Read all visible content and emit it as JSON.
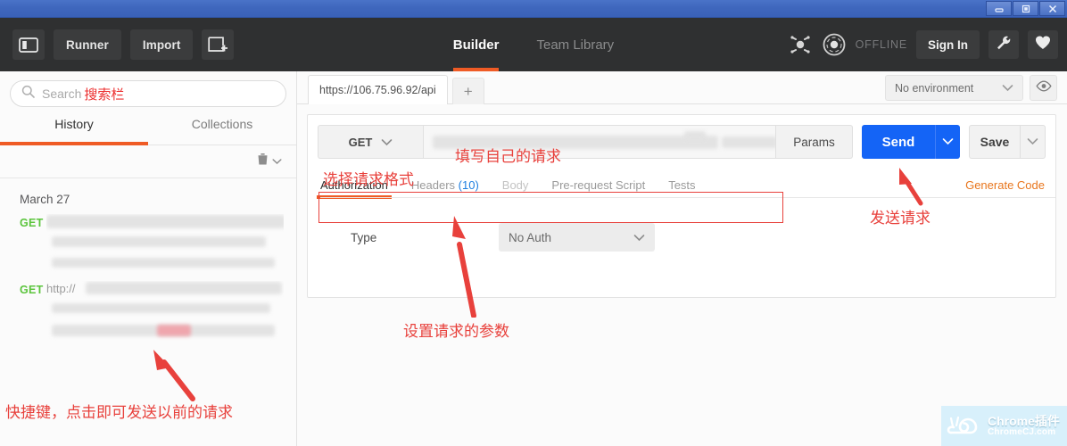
{
  "window": {
    "minimize_label": "Minimize",
    "maximize_label": "Maximize",
    "close_label": "Close"
  },
  "header": {
    "sidebar_toggle_icon": "sidebar-toggle-icon",
    "runner_label": "Runner",
    "import_label": "Import",
    "new_window_icon": "new-window-icon",
    "tabs": [
      {
        "label": "Builder",
        "active": true
      },
      {
        "label": "Team Library",
        "active": false
      }
    ],
    "sync_icon": "sync-atom-icon",
    "status_icon": "offline-atom-icon",
    "status_label": "OFFLINE",
    "signin_label": "Sign In",
    "wrench_icon": "wrench-icon",
    "heart_icon": "heart-icon"
  },
  "sidebar": {
    "search": {
      "placeholder": "Search",
      "icon": "search-icon",
      "annotation": "搜索栏"
    },
    "tabs": [
      {
        "label": "History",
        "active": true
      },
      {
        "label": "Collections",
        "active": false
      }
    ],
    "trash_icon": "trash-icon",
    "trash_caret_icon": "chevron-down-icon",
    "history": {
      "day_label": "March 27",
      "items": [
        {
          "method": "GET",
          "url_prefix": "",
          "redacted": true
        },
        {
          "method": "GET",
          "url_prefix": "http://",
          "redacted": true
        }
      ]
    }
  },
  "main": {
    "request_tabs": [
      {
        "label": "https://106.75.96.92/api",
        "active": true
      }
    ],
    "add_tab_label": "+",
    "environment": {
      "selected": "No environment",
      "caret_icon": "chevron-down-icon",
      "eye_icon": "eye-icon"
    },
    "request": {
      "method": "GET",
      "method_caret_icon": "chevron-down-icon",
      "url_value": "",
      "url_redacted": true,
      "params_label": "Params",
      "send_label": "Send",
      "send_caret_icon": "chevron-down-icon",
      "save_label": "Save",
      "save_caret_icon": "chevron-down-icon"
    },
    "sub_tabs": [
      {
        "label": "Authorization",
        "count": "",
        "active": true,
        "dim": false
      },
      {
        "label": "Headers",
        "count": "(10)",
        "active": false,
        "dim": false
      },
      {
        "label": "Body",
        "count": "",
        "active": false,
        "dim": true
      },
      {
        "label": "Pre-request Script",
        "count": "",
        "active": false,
        "dim": false
      },
      {
        "label": "Tests",
        "count": "",
        "active": false,
        "dim": false
      }
    ],
    "generate_code_label": "Generate Code",
    "auth": {
      "type_label": "Type",
      "type_value": "No Auth",
      "caret_icon": "chevron-down-icon"
    }
  },
  "annotations": [
    {
      "id": "fill-request",
      "text": "填写自己的请求"
    },
    {
      "id": "choose-method",
      "text": "选择请求格式"
    },
    {
      "id": "send-request",
      "text": "发送请求"
    },
    {
      "id": "set-params",
      "text": "设置请求的参数"
    },
    {
      "id": "history-shortcut",
      "text": "快捷键，点击即可发送以前的请求"
    }
  ],
  "watermark": {
    "title": "Chrome插件",
    "subtitle": "ChromeCJ.com",
    "logo_icon": "snail-icon"
  },
  "colors": {
    "titlebar": "#3f67bd",
    "header_bg": "#2f3031",
    "accent_orange": "#ef5b25",
    "send_blue": "#1464f6",
    "method_green": "#5bc43c",
    "annotation_red": "#e8413c",
    "generate_code": "#e8761d"
  }
}
